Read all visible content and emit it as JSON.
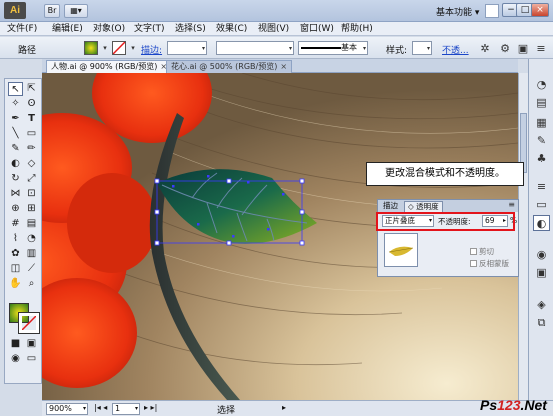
{
  "title_bar": {
    "logo": "Ai",
    "workspace": "基本功能",
    "window_buttons": [
      "−",
      "□",
      "×"
    ]
  },
  "menu": [
    "文件(F)",
    "编辑(E)",
    "对象(O)",
    "文字(T)",
    "选择(S)",
    "效果(C)",
    "视图(V)",
    "窗口(W)",
    "帮助(H)"
  ],
  "control_bar": {
    "object_type": "路径",
    "stroke_label": "描边:",
    "brush_label": "基本",
    "style_label": "样式:",
    "opacity_link": "不透..."
  },
  "doc_tabs": [
    {
      "label": "人物.ai @ 900% (RGB/预览)",
      "active": true
    },
    {
      "label": "花心.ai @ 500% (RGB/预览)",
      "active": false
    }
  ],
  "transparency_panel": {
    "tab_stroke": "描边",
    "tab_transparency": "透明度",
    "blend_mode": "正片叠底",
    "opacity_label": "不透明度:",
    "opacity_value": "69",
    "percent": "%",
    "clip_label": "剪切",
    "invert_mask_label": "反相蒙版"
  },
  "callout": "更改混合模式和不透明度。",
  "status_bar": {
    "zoom": "900%",
    "page": "1",
    "tool": "选择"
  },
  "watermark": {
    "prefix": "Ps",
    "accent": "123",
    "suffix": ".Net"
  },
  "colors": {
    "highlight": "#e3141b",
    "ui_blue": "#c9d6ea",
    "selection": "#3a3aff"
  },
  "icons": {
    "selection_tool": "selection-arrow-icon",
    "type_tool": "type-t-icon",
    "hand_tool": "hand-icon",
    "zoom_tool": "zoom-magnifier-icon"
  }
}
